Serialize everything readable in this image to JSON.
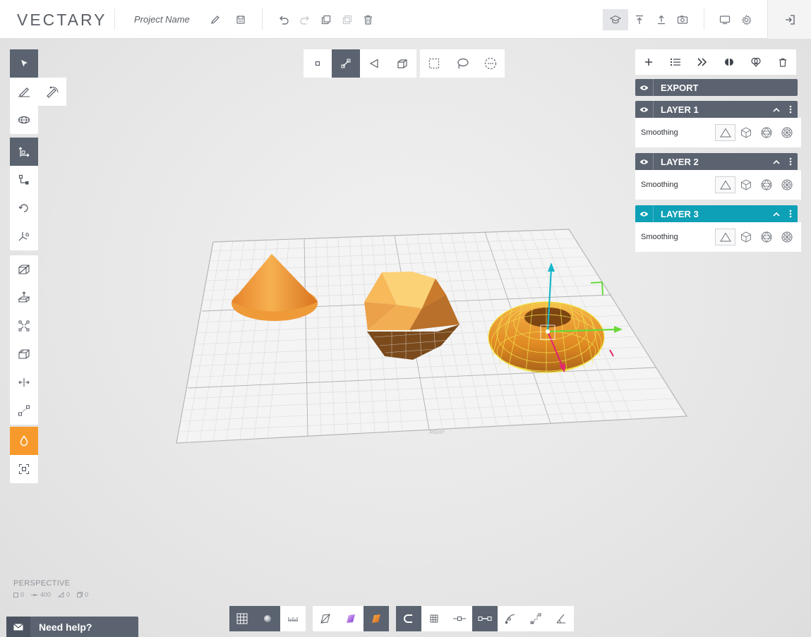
{
  "app": {
    "logo": "VECTARY",
    "project_name": "Project Name"
  },
  "toolbar": {
    "left": [
      "edit-name-icon",
      "save-icon",
      "undo-icon",
      "redo-icon",
      "duplicate-icon",
      "copy-icon",
      "delete-icon"
    ],
    "right": [
      "learn-icon",
      "export-icon",
      "upload-icon",
      "screenshot-icon",
      "display-icon",
      "settings-icon"
    ],
    "active": "learn-icon",
    "exit_icon": "exit-icon"
  },
  "selection_modes": {
    "items": [
      "vertex",
      "edge",
      "face",
      "object"
    ],
    "active": "edge",
    "tools": [
      "box-select",
      "lasso-select",
      "paint-select"
    ]
  },
  "right_panel": {
    "tools": [
      "add",
      "list",
      "forward",
      "mirror",
      "group",
      "delete"
    ],
    "export_label": "EXPORT",
    "layers": [
      {
        "name": "LAYER 1",
        "smoothing_label": "Smoothing",
        "active": false
      },
      {
        "name": "LAYER 2",
        "smoothing_label": "Smoothing",
        "active": false
      },
      {
        "name": "LAYER 3",
        "smoothing_label": "Smoothing",
        "active": true
      }
    ],
    "smoothing_options": [
      "none",
      "low",
      "medium",
      "high"
    ],
    "smoothing_selected": "none"
  },
  "viewport": {
    "camera_label": "PERSPECTIVE",
    "stats": [
      "0",
      "400",
      "0",
      "0"
    ],
    "grid_label": "RIGHT"
  },
  "help": {
    "label": "Need help?"
  },
  "bottom": {
    "view_group": [
      "grid",
      "shaded-sphere",
      "ruler"
    ],
    "view_active": "grid",
    "material_group": [
      "wireframe",
      "xray",
      "solid"
    ],
    "material_active": "solid",
    "snap_group": [
      "magnet",
      "grid-snap",
      "vertex-snap",
      "edge-snap",
      "curve",
      "steps",
      "angle"
    ],
    "snap_active": [
      "magnet",
      "edge-snap"
    ]
  },
  "colors": {
    "accent": "#f89a2b",
    "panel_dark": "#5b6370",
    "active_layer": "#0ea0b6"
  }
}
